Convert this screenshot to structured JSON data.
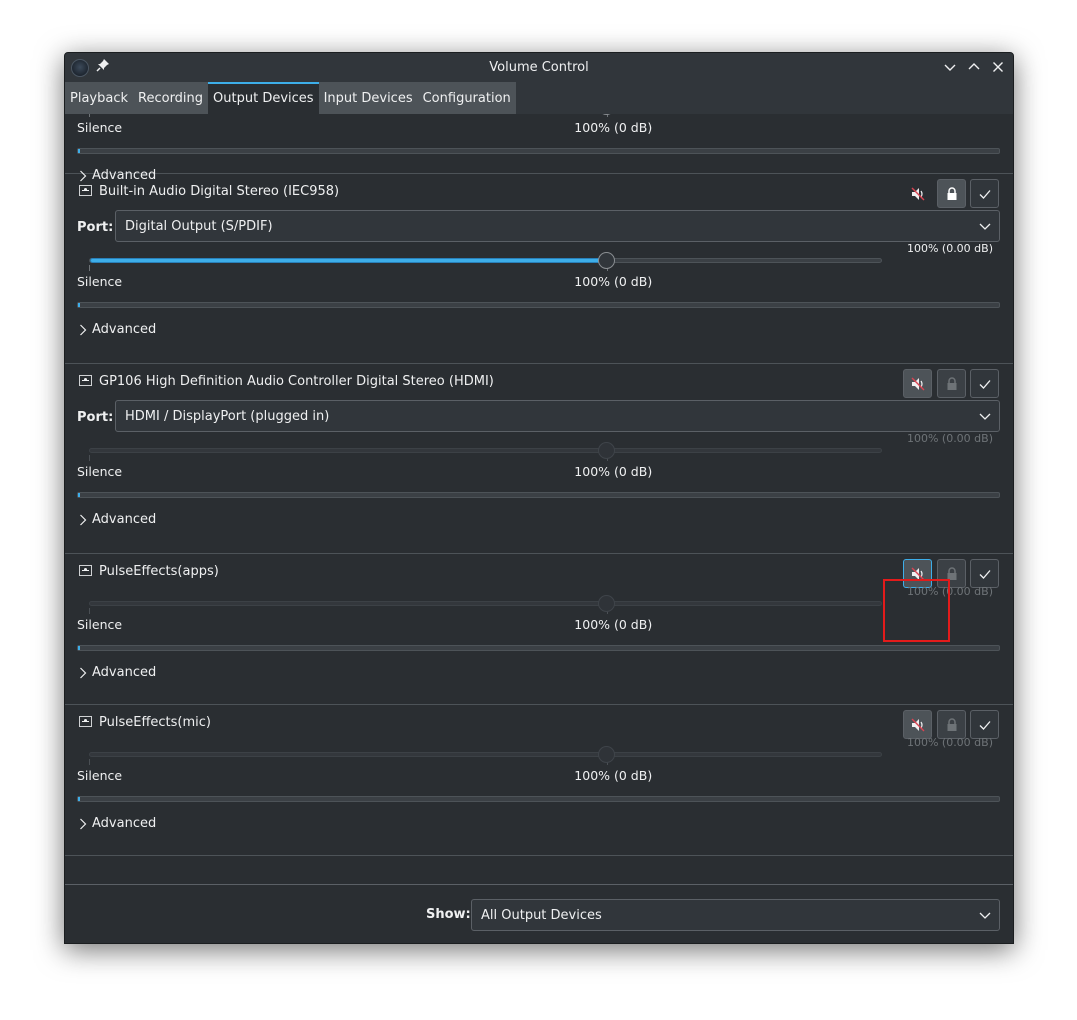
{
  "window": {
    "title": "Volume Control"
  },
  "tabs": [
    {
      "label": "Playback",
      "active": false
    },
    {
      "label": "Recording",
      "active": false
    },
    {
      "label": "Output Devices",
      "active": true
    },
    {
      "label": "Input Devices",
      "active": false
    },
    {
      "label": "Configuration",
      "active": false
    }
  ],
  "scale": {
    "silence_label": "Silence",
    "hundred_label": "100% (0 dB)"
  },
  "advanced_label": "Advanced",
  "port_label": "Port:",
  "devices": [
    {
      "name": "",
      "partially_visible": true,
      "volume_percent": 100,
      "meter_level": 0
    },
    {
      "name": "Built-in Audio Digital Stereo (IEC958)",
      "port": "Digital Output (S/PDIF)",
      "volume_percent": 100,
      "volume_readout": "100% (0.00 dB)",
      "muted": false,
      "locked": true,
      "is_default": false,
      "enabled": true,
      "meter_level": 0
    },
    {
      "name": "GP106 High Definition Audio Controller Digital Stereo (HDMI)",
      "port": "HDMI / DisplayPort (plugged in)",
      "volume_percent": 100,
      "volume_readout": "100% (0.00 dB)",
      "muted": true,
      "locked": false,
      "is_default": false,
      "enabled": false,
      "meter_level": 0
    },
    {
      "name": "PulseEffects(apps)",
      "volume_percent": 100,
      "volume_readout": "100% (0.00 dB)",
      "muted": true,
      "locked": false,
      "is_default": false,
      "enabled": false,
      "focused_button": "mute",
      "meter_level": 0
    },
    {
      "name": "PulseEffects(mic)",
      "volume_percent": 100,
      "volume_readout": "100% (0.00 dB)",
      "muted": true,
      "locked": false,
      "is_default": false,
      "enabled": false,
      "meter_level": 0
    }
  ],
  "footer": {
    "show_label": "Show:",
    "show_value": "All Output Devices"
  },
  "colors": {
    "accent": "#3daee9",
    "background": "#2a2e32",
    "highlight_box": "#e31b1b",
    "mute_slash": "#da4453"
  }
}
